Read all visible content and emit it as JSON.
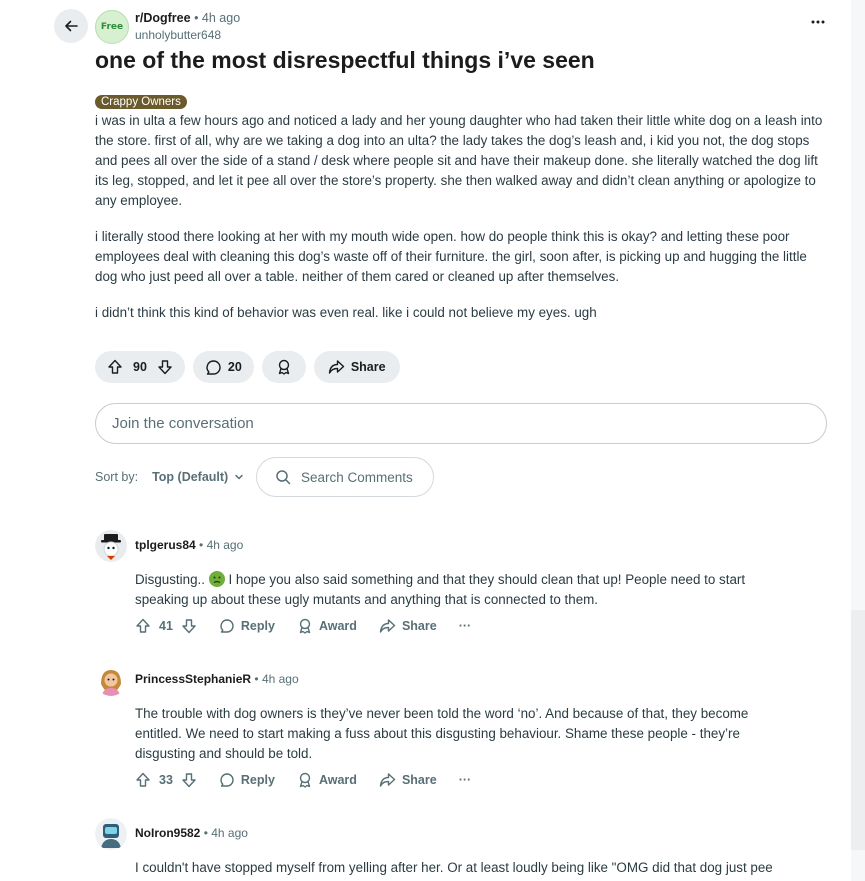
{
  "post": {
    "subreddit": "r/Dogfree",
    "time": "4h ago",
    "author": "unholybutter648",
    "avatar_text": "Free",
    "title": "one of the most disrespectful things i’ve seen",
    "flair": "Crappy Owners",
    "paragraphs": [
      "i was in ulta a few hours ago and noticed a lady and her young daughter who had taken their little white dog on a leash into the store. first of all, why are we taking a dog into an ulta? the lady takes the dog’s leash and, i kid you not, the dog stops and pees all over the side of a stand / desk where people sit and have their makeup done. she literally watched the dog lift its leg, stopped, and let it pee all over the store’s property. she then walked away and didn’t clean anything or apologize to any employee.",
      "i literally stood there looking at her with my mouth wide open. how do people think this is okay? and letting these poor employees deal with cleaning this dog’s waste off of their furniture. the girl, soon after, is picking up and hugging the little dog who just peed all over a table. neither of them cared or cleaned up after themselves.",
      "i didn’t think this kind of behavior was even real. like i could not believe my eyes. ugh"
    ],
    "votes": "90",
    "comments": "20",
    "share_label": "Share"
  },
  "join_placeholder": "Join the conversation",
  "sort": {
    "label": "Sort by:",
    "value": "Top (Default)"
  },
  "search_placeholder": "Search Comments",
  "comments": [
    {
      "user": "tplgerus84",
      "time": "4h ago",
      "text_before": "Disgusting..",
      "text_after": " I hope you also said something and that they should clean that up! People need to start speaking up about these ugly mutants and anything that is connected to them.",
      "votes": "41",
      "reply": "Reply",
      "award": "Award",
      "share": "Share",
      "more": "···"
    },
    {
      "user": "PrincessStephanieR",
      "time": "4h ago",
      "text": "The trouble with dog owners is they’ve never been told the word ‘no’. And because of that, they become entitled. We need to start making a fuss about this disgusting behaviour. Shame these people - they’re disgusting and should be told.",
      "votes": "33",
      "reply": "Reply",
      "award": "Award",
      "share": "Share",
      "more": "···"
    },
    {
      "user": "NoIron9582",
      "time": "4h ago",
      "text": "I couldn't have stopped myself from yelling after her. Or at least loudly being like \"OMG did that dog just pee"
    }
  ],
  "colors": {
    "flair_bg": "#6b5a2b",
    "pill_bg": "#eaedef",
    "meta": "#576f76",
    "emoji": "#6fae3a"
  },
  "icons": [
    "back-arrow-icon",
    "more-icon",
    "upvote-icon",
    "downvote-icon",
    "comment-icon",
    "award-icon",
    "share-icon",
    "search-icon",
    "chevron-down-icon",
    "reply-icon",
    "sick-face-emoji"
  ]
}
